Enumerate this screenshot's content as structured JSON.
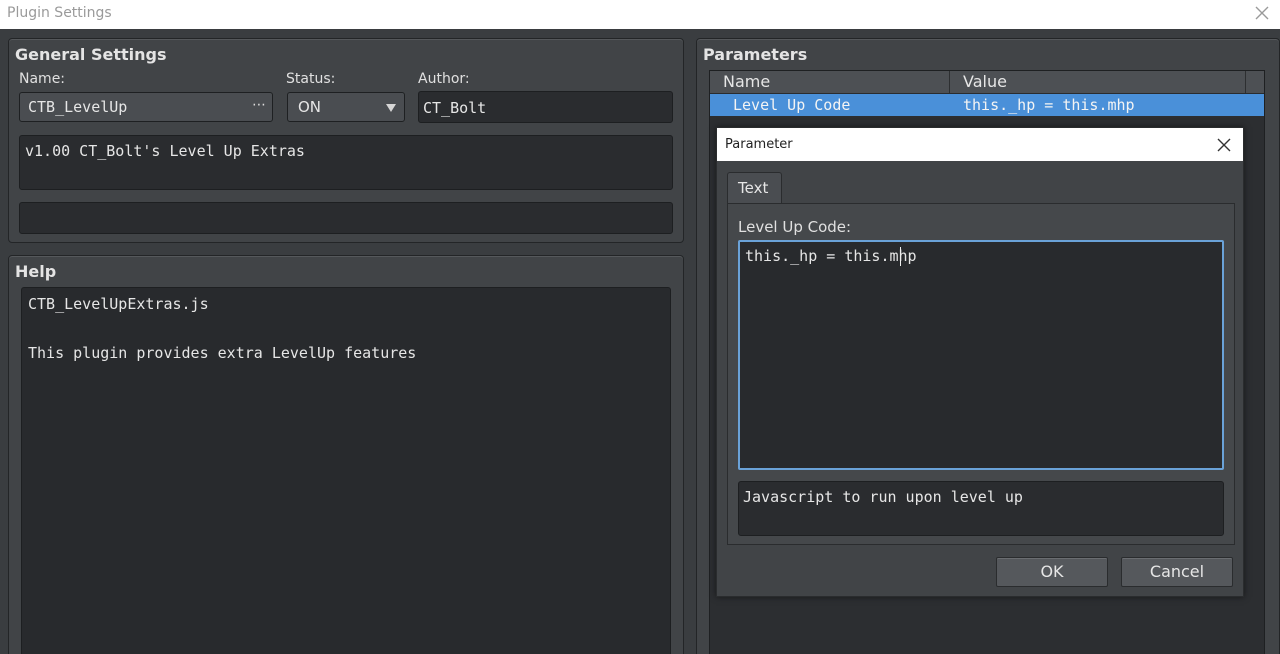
{
  "window": {
    "title": "Plugin Settings"
  },
  "general": {
    "heading": "General Settings",
    "name_label": "Name:",
    "name_value": "CTB_LevelUp",
    "name_button": "⋯",
    "status_label": "Status:",
    "status_value": "ON",
    "author_label": "Author:",
    "author_value": "CT_Bolt",
    "description": "v1.00 CT_Bolt's Level Up Extras",
    "extra": ""
  },
  "help": {
    "heading": "Help",
    "line1": "CTB_LevelUpExtras.js",
    "line2": "This plugin provides extra LevelUp features"
  },
  "parameters": {
    "heading": "Parameters",
    "col_name": "Name",
    "col_value": "Value",
    "rows": [
      {
        "name": "Level Up Code",
        "value": "this._hp = this.mhp"
      }
    ]
  },
  "dialog": {
    "title": "Parameter",
    "tab": "Text",
    "field_label": "Level Up Code:",
    "field_value": "this._hp = this.mhp",
    "description": "Javascript to run upon level up",
    "ok": "OK",
    "cancel": "Cancel"
  },
  "colors": {
    "selection": "#4a90d9",
    "focus_border": "#6aa2d8"
  }
}
